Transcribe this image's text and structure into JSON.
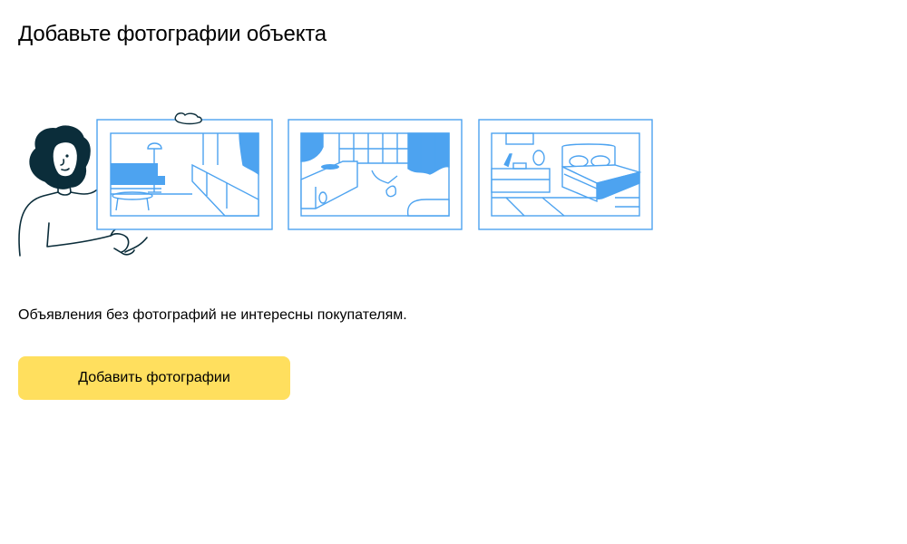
{
  "page": {
    "title": "Добавьте фотографии объекта",
    "description": "Объявления без фотографий не интересны покупателям."
  },
  "actions": {
    "add_photos_label": "Добавить фотографии"
  },
  "illustration": {
    "icon": "woman-holding-room-photos-illustration",
    "frames": [
      "living-room",
      "bathroom",
      "bedroom"
    ]
  },
  "colors": {
    "accent_button": "#ffdf5e",
    "illustration_blue": "#4da3f0",
    "illustration_dark": "#0b2d3a"
  }
}
